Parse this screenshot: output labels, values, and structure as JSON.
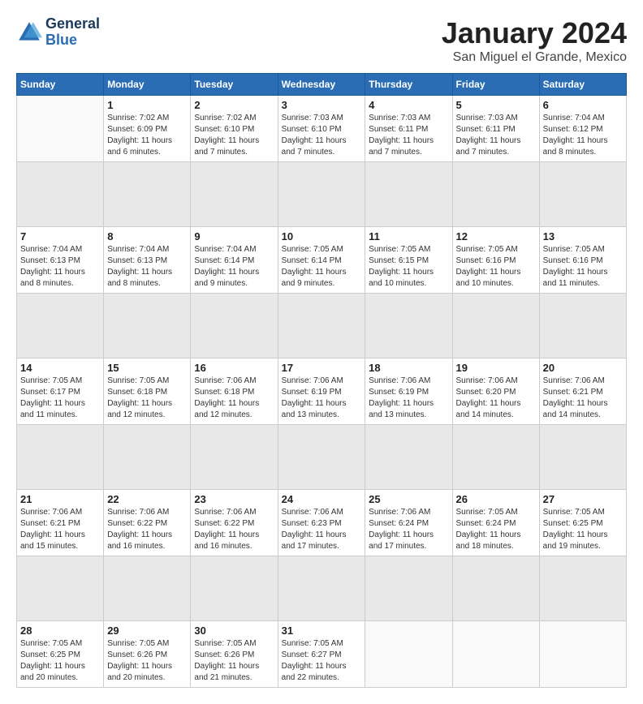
{
  "logo": {
    "line1": "General",
    "line2": "Blue"
  },
  "title": "January 2024",
  "location": "San Miguel el Grande, Mexico",
  "days_of_week": [
    "Sunday",
    "Monday",
    "Tuesday",
    "Wednesday",
    "Thursday",
    "Friday",
    "Saturday"
  ],
  "weeks": [
    [
      {
        "day": "",
        "sunrise": "",
        "sunset": "",
        "daylight": ""
      },
      {
        "day": "1",
        "sunrise": "Sunrise: 7:02 AM",
        "sunset": "Sunset: 6:09 PM",
        "daylight": "Daylight: 11 hours and 6 minutes."
      },
      {
        "day": "2",
        "sunrise": "Sunrise: 7:02 AM",
        "sunset": "Sunset: 6:10 PM",
        "daylight": "Daylight: 11 hours and 7 minutes."
      },
      {
        "day": "3",
        "sunrise": "Sunrise: 7:03 AM",
        "sunset": "Sunset: 6:10 PM",
        "daylight": "Daylight: 11 hours and 7 minutes."
      },
      {
        "day": "4",
        "sunrise": "Sunrise: 7:03 AM",
        "sunset": "Sunset: 6:11 PM",
        "daylight": "Daylight: 11 hours and 7 minutes."
      },
      {
        "day": "5",
        "sunrise": "Sunrise: 7:03 AM",
        "sunset": "Sunset: 6:11 PM",
        "daylight": "Daylight: 11 hours and 7 minutes."
      },
      {
        "day": "6",
        "sunrise": "Sunrise: 7:04 AM",
        "sunset": "Sunset: 6:12 PM",
        "daylight": "Daylight: 11 hours and 8 minutes."
      }
    ],
    [
      {
        "day": "7",
        "sunrise": "Sunrise: 7:04 AM",
        "sunset": "Sunset: 6:13 PM",
        "daylight": "Daylight: 11 hours and 8 minutes."
      },
      {
        "day": "8",
        "sunrise": "Sunrise: 7:04 AM",
        "sunset": "Sunset: 6:13 PM",
        "daylight": "Daylight: 11 hours and 8 minutes."
      },
      {
        "day": "9",
        "sunrise": "Sunrise: 7:04 AM",
        "sunset": "Sunset: 6:14 PM",
        "daylight": "Daylight: 11 hours and 9 minutes."
      },
      {
        "day": "10",
        "sunrise": "Sunrise: 7:05 AM",
        "sunset": "Sunset: 6:14 PM",
        "daylight": "Daylight: 11 hours and 9 minutes."
      },
      {
        "day": "11",
        "sunrise": "Sunrise: 7:05 AM",
        "sunset": "Sunset: 6:15 PM",
        "daylight": "Daylight: 11 hours and 10 minutes."
      },
      {
        "day": "12",
        "sunrise": "Sunrise: 7:05 AM",
        "sunset": "Sunset: 6:16 PM",
        "daylight": "Daylight: 11 hours and 10 minutes."
      },
      {
        "day": "13",
        "sunrise": "Sunrise: 7:05 AM",
        "sunset": "Sunset: 6:16 PM",
        "daylight": "Daylight: 11 hours and 11 minutes."
      }
    ],
    [
      {
        "day": "14",
        "sunrise": "Sunrise: 7:05 AM",
        "sunset": "Sunset: 6:17 PM",
        "daylight": "Daylight: 11 hours and 11 minutes."
      },
      {
        "day": "15",
        "sunrise": "Sunrise: 7:05 AM",
        "sunset": "Sunset: 6:18 PM",
        "daylight": "Daylight: 11 hours and 12 minutes."
      },
      {
        "day": "16",
        "sunrise": "Sunrise: 7:06 AM",
        "sunset": "Sunset: 6:18 PM",
        "daylight": "Daylight: 11 hours and 12 minutes."
      },
      {
        "day": "17",
        "sunrise": "Sunrise: 7:06 AM",
        "sunset": "Sunset: 6:19 PM",
        "daylight": "Daylight: 11 hours and 13 minutes."
      },
      {
        "day": "18",
        "sunrise": "Sunrise: 7:06 AM",
        "sunset": "Sunset: 6:19 PM",
        "daylight": "Daylight: 11 hours and 13 minutes."
      },
      {
        "day": "19",
        "sunrise": "Sunrise: 7:06 AM",
        "sunset": "Sunset: 6:20 PM",
        "daylight": "Daylight: 11 hours and 14 minutes."
      },
      {
        "day": "20",
        "sunrise": "Sunrise: 7:06 AM",
        "sunset": "Sunset: 6:21 PM",
        "daylight": "Daylight: 11 hours and 14 minutes."
      }
    ],
    [
      {
        "day": "21",
        "sunrise": "Sunrise: 7:06 AM",
        "sunset": "Sunset: 6:21 PM",
        "daylight": "Daylight: 11 hours and 15 minutes."
      },
      {
        "day": "22",
        "sunrise": "Sunrise: 7:06 AM",
        "sunset": "Sunset: 6:22 PM",
        "daylight": "Daylight: 11 hours and 16 minutes."
      },
      {
        "day": "23",
        "sunrise": "Sunrise: 7:06 AM",
        "sunset": "Sunset: 6:22 PM",
        "daylight": "Daylight: 11 hours and 16 minutes."
      },
      {
        "day": "24",
        "sunrise": "Sunrise: 7:06 AM",
        "sunset": "Sunset: 6:23 PM",
        "daylight": "Daylight: 11 hours and 17 minutes."
      },
      {
        "day": "25",
        "sunrise": "Sunrise: 7:06 AM",
        "sunset": "Sunset: 6:24 PM",
        "daylight": "Daylight: 11 hours and 17 minutes."
      },
      {
        "day": "26",
        "sunrise": "Sunrise: 7:05 AM",
        "sunset": "Sunset: 6:24 PM",
        "daylight": "Daylight: 11 hours and 18 minutes."
      },
      {
        "day": "27",
        "sunrise": "Sunrise: 7:05 AM",
        "sunset": "Sunset: 6:25 PM",
        "daylight": "Daylight: 11 hours and 19 minutes."
      }
    ],
    [
      {
        "day": "28",
        "sunrise": "Sunrise: 7:05 AM",
        "sunset": "Sunset: 6:25 PM",
        "daylight": "Daylight: 11 hours and 20 minutes."
      },
      {
        "day": "29",
        "sunrise": "Sunrise: 7:05 AM",
        "sunset": "Sunset: 6:26 PM",
        "daylight": "Daylight: 11 hours and 20 minutes."
      },
      {
        "day": "30",
        "sunrise": "Sunrise: 7:05 AM",
        "sunset": "Sunset: 6:26 PM",
        "daylight": "Daylight: 11 hours and 21 minutes."
      },
      {
        "day": "31",
        "sunrise": "Sunrise: 7:05 AM",
        "sunset": "Sunset: 6:27 PM",
        "daylight": "Daylight: 11 hours and 22 minutes."
      },
      {
        "day": "",
        "sunrise": "",
        "sunset": "",
        "daylight": ""
      },
      {
        "day": "",
        "sunrise": "",
        "sunset": "",
        "daylight": ""
      },
      {
        "day": "",
        "sunrise": "",
        "sunset": "",
        "daylight": ""
      }
    ]
  ]
}
